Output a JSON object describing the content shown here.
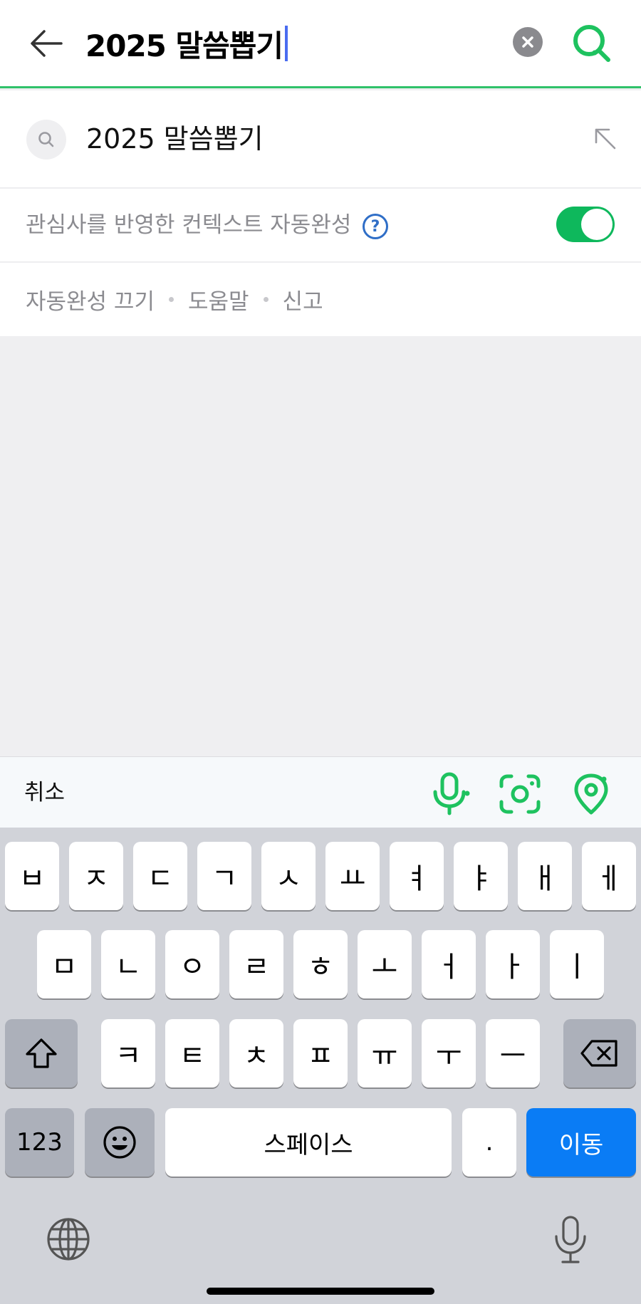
{
  "search": {
    "query": "2025 말씀뽑기"
  },
  "suggestions": [
    {
      "text": "2025 말씀뽑기"
    }
  ],
  "context_autocomplete": {
    "label": "관심사를 반영한 컨텍스트 자동완성",
    "help_glyph": "?",
    "enabled": true
  },
  "links": {
    "off": "자동완성 끄기",
    "help": "도움말",
    "report": "신고"
  },
  "accessory": {
    "cancel": "취소",
    "icons": [
      "microphone-icon",
      "lens-camera-icon",
      "location-pin-icon"
    ]
  },
  "colors": {
    "accent_green": "#2fc26a",
    "toggle_green": "#0eb85c",
    "go_blue": "#0a7cf5",
    "help_blue": "#2f6ec7"
  },
  "keyboard": {
    "row1": [
      "ㅂ",
      "ㅈ",
      "ㄷ",
      "ㄱ",
      "ㅅ",
      "ㅛ",
      "ㅕ",
      "ㅑ",
      "ㅐ",
      "ㅔ"
    ],
    "row2": [
      "ㅁ",
      "ㄴ",
      "ㅇ",
      "ㄹ",
      "ㅎ",
      "ㅗ",
      "ㅓ",
      "ㅏ",
      "ㅣ"
    ],
    "row3": [
      "ㅋ",
      "ㅌ",
      "ㅊ",
      "ㅍ",
      "ㅠ",
      "ㅜ",
      "ㅡ"
    ],
    "numbers": "123",
    "space": "스페이스",
    "period": ".",
    "go": "이동"
  }
}
